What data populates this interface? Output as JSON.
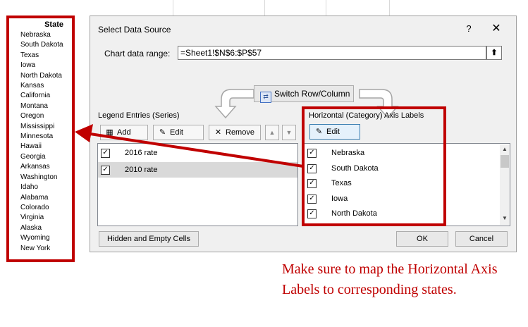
{
  "colors": {
    "highlight": "#c00000",
    "dialog_bg": "#f0f0f0",
    "selected_row": "#d9d9d9"
  },
  "state_list": {
    "header": "State",
    "items": [
      "Nebraska",
      "South Dakota",
      "Texas",
      "Iowa",
      "North Dakota",
      "Kansas",
      "California",
      "Montana",
      "Oregon",
      "Mississippi",
      "Minnesota",
      "Hawaii",
      "Georgia",
      "Arkansas",
      "Washington",
      "Idaho",
      "Alabama",
      "Colorado",
      "Virginia",
      "Alaska",
      "Wyoming",
      "New York"
    ]
  },
  "dialog": {
    "title": "Select Data Source",
    "help": "?",
    "close": "✕",
    "range_label": "Chart data range:",
    "range_value": "=Sheet1!$N$6:$P$57",
    "range_collapse_icon": "collapse-icon",
    "switch_label": "Switch Row/Column",
    "legend": {
      "label": "Legend Entries (Series)",
      "add": "Add",
      "edit": "Edit",
      "remove": "Remove",
      "series": [
        {
          "label": "2016 rate",
          "checked": true,
          "selected": false
        },
        {
          "label": "2010 rate",
          "checked": true,
          "selected": true
        }
      ]
    },
    "axis": {
      "label": "Horizontal (Category) Axis Labels",
      "edit": "Edit",
      "items": [
        {
          "label": "Nebraska",
          "checked": true
        },
        {
          "label": "South Dakota",
          "checked": true
        },
        {
          "label": "Texas",
          "checked": true
        },
        {
          "label": "Iowa",
          "checked": true
        },
        {
          "label": "North Dakota",
          "checked": true
        }
      ]
    },
    "hidden_cells": "Hidden and Empty Cells",
    "ok": "OK",
    "cancel": "Cancel"
  },
  "note": "Make sure to map the Horizontal Axis Labels to corresponding states."
}
